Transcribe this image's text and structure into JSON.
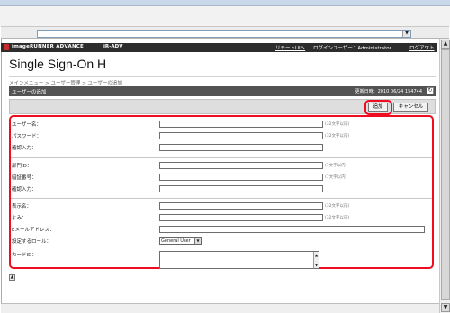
{
  "browser": {
    "dropdown_icon": "chevron-down-icon"
  },
  "header": {
    "brand": "imageRUNNER ADVANCE",
    "device": "iR-ADV",
    "remote_ui_link": "リモートUIへ",
    "login_user": "ログインユーザー：Administrator",
    "logout_link": "ログアウト",
    "app_title": "Single Sign-On H"
  },
  "breadcrumb": "メインメニュー > ユーザー管理 > ユーザーの追加",
  "section": {
    "title": "ユーザーの追加",
    "updated": "更新日時：2010 06/24 154744",
    "refresh_icon": "refresh-icon"
  },
  "actions": {
    "add": "追加",
    "cancel": "キャンセル"
  },
  "form": {
    "user_name_label": "ユーザー名：",
    "user_name_hint": "(32文字以内)",
    "password_label": "パスワード：",
    "password_hint": "(32文字以内)",
    "confirm_password_label": "確認入力：",
    "department_id_label": "部門ID：",
    "department_id_hint": "(7文字以内)",
    "pin_label": "暗証番号：",
    "pin_hint": "(7文字以内)",
    "confirm_pin_label": "確認入力：",
    "display_name_label": "表示名：",
    "display_name_hint": "(32文字以内)",
    "reading_label": "よみ：",
    "reading_hint": "(32文字以内)",
    "email_label": "Eメールアドレス：",
    "role_label": "設定するロール：",
    "role_value": "General User",
    "card_id_label": "カードID："
  }
}
